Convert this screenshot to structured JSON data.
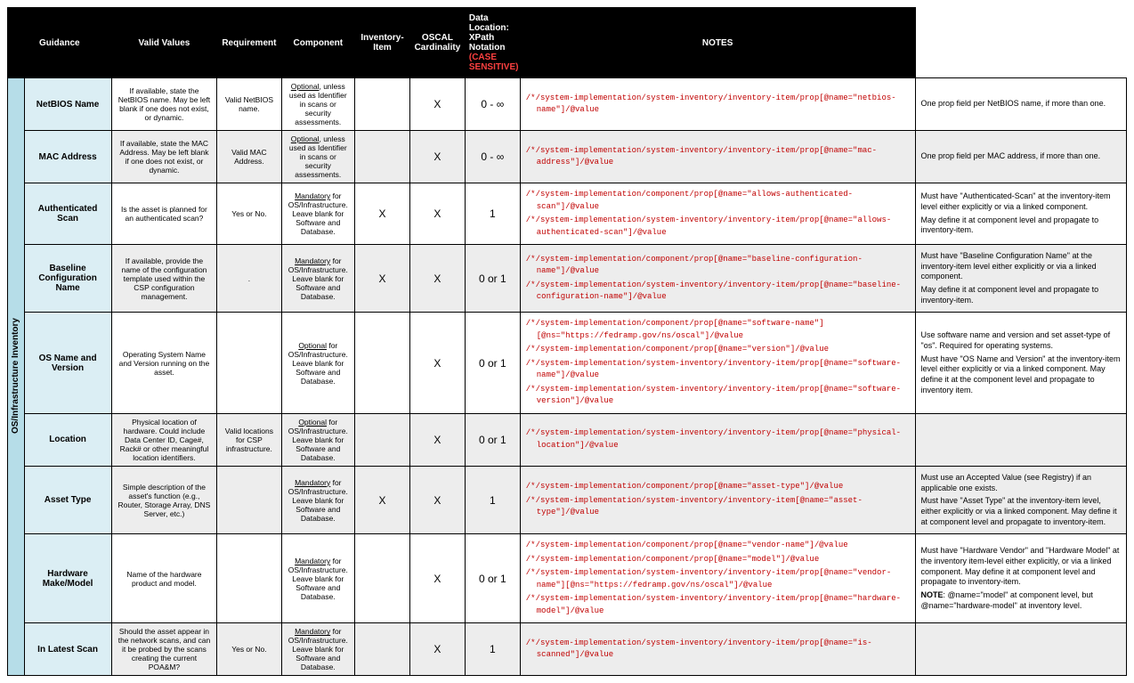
{
  "section": "OS/Infrastructure Inventory",
  "headers": {
    "c1": "Guidance",
    "c2": "Valid Values",
    "c3": "Requirement",
    "c4": "Component",
    "c5": "Inventory-Item",
    "c6": "OSCAL Cardinality",
    "c7a": "Data Location: XPath Notation ",
    "c7b": "(CASE SENSITIVE)",
    "c8": "NOTES"
  },
  "rows": [
    {
      "name": "NetBIOS Name",
      "guidance": "If available, state the NetBIOS name. May be left blank if one does not exist, or dynamic.",
      "valid": "Valid NetBIOS name.",
      "req_pre": "Optional",
      "req_post": ", unless used as Identifier in scans or security assessments.",
      "comp": "",
      "inv": "X",
      "card": "0 - ∞",
      "xpaths": [
        "/*/system-implementation/system-inventory/inventory-item/prop[@name=\"netbios-name\"]/@value"
      ],
      "notes": [
        "One prop field per NetBIOS name, if more than one."
      ],
      "shade": false
    },
    {
      "name": "MAC Address",
      "guidance": "If available, state the MAC Address. May be left blank if one does not exist, or dynamic.",
      "valid": "Valid MAC Address.",
      "req_pre": "Optional",
      "req_post": ", unless used as Identifier in scans or security assessments.",
      "comp": "",
      "inv": "X",
      "card": "0 - ∞",
      "xpaths": [
        "/*/system-implementation/system-inventory/inventory-item/prop[@name=\"mac-address\"]/@value"
      ],
      "notes": [
        "One prop field per MAC address, if more than one."
      ],
      "shade": true
    },
    {
      "name": "Authenticated Scan",
      "guidance": "Is the asset is planned for an authenticated scan?",
      "valid": "Yes or No.",
      "req_pre": "Mandatory",
      "req_post": " for OS/Infrastructure. Leave blank for Software and Database.",
      "comp": "X",
      "inv": "X",
      "card": "1",
      "xpaths": [
        "/*/system-implementation/component/prop[@name=\"allows-authenticated-scan\"]/@value",
        "/*/system-implementation/system-inventory/inventory-item/prop[@name=\"allows-authenticated-scan\"]/@value"
      ],
      "notes": [
        "Must have \"Authenticated-Scan\" at the inventory-item level either explicitly or via a linked component.",
        "May define it at component level and propagate to inventory-item."
      ],
      "shade": false
    },
    {
      "name": "Baseline Configuration Name",
      "guidance": "If available, provide the name of the configuration template used within the CSP configuration management.",
      "valid": ".",
      "req_pre": "Mandatory",
      "req_post": " for OS/Infrastructure. Leave blank for Software and Database.",
      "comp": "X",
      "inv": "X",
      "card": "0 or 1",
      "xpaths": [
        "/*/system-implementation/component/prop[@name=\"baseline-configuration-name\"]/@value",
        "/*/system-implementation/system-inventory/inventory-item/prop[@name=\"baseline-configuration-name\"]/@value"
      ],
      "notes": [
        "Must have \"Baseline Configuration Name\" at the inventory-item level either explicitly or via a linked component.",
        "May define it at component level and propagate to inventory-item."
      ],
      "shade": true
    },
    {
      "name": "OS Name and Version",
      "guidance": "Operating System Name and Version running on the asset.",
      "valid": "",
      "req_pre": "Optional",
      "req_post": " for OS/Infrastructure. Leave blank for Software and Database.",
      "comp": "",
      "inv": "X",
      "card": "0 or 1",
      "xpaths": [
        "/*/system-implementation/component/prop[@name=\"software-name\"][@ns=\"https://fedramp.gov/ns/oscal\"]/@value",
        "/*/system-implementation/component/prop[@name=\"version\"]/@value",
        "/*/system-implementation/system-inventory/inventory-item/prop[@name=\"software-name\"]/@value",
        "/*/system-implementation/system-inventory/inventory-item/prop[@name=\"software-version\"]/@value"
      ],
      "notes": [
        "Use software name and version and set asset-type of \"os\".\nRequired for operating systems.",
        "Must have \"OS Name and Version\" at the inventory-item level either explicitly or via a linked component. May define it at the component level and propagate to inventory item."
      ],
      "shade": false
    },
    {
      "name": "Location",
      "guidance": "Physical location of hardware. Could include Data Center ID, Cage#, Rack# or other meaningful location identifiers.",
      "valid": "Valid locations for CSP infrastructure.",
      "req_pre": "Optional",
      "req_post": " for OS/Infrastructure. Leave blank for Software and Database.",
      "comp": "",
      "inv": "X",
      "card": "0 or 1",
      "xpaths": [
        "/*/system-implementation/system-inventory/inventory-item/prop[@name=\"physical-location\"]/@value"
      ],
      "notes": [],
      "shade": true
    },
    {
      "name": "Asset Type",
      "guidance": "Simple description of the asset's function (e.g., Router, Storage Array, DNS Server, etc.)",
      "valid": "",
      "req_pre": "Mandatory",
      "req_post": " for OS/Infrastructure. Leave blank for Software and Database.",
      "comp": "X",
      "inv": "X",
      "card": "1",
      "xpaths": [
        "/*/system-implementation/component/prop[@name=\"asset-type\"]/@value",
        "/*/system-implementation/system-inventory/inventory-item[@name=\"asset-type\"]/@value"
      ],
      "notes": [
        "Must use an Accepted Value (see Registry) if an applicable one exists.",
        "Must have \"Asset Type\" at the inventory-item level, either explicitly or via a linked component. May define it at component level and propagate to inventory-item."
      ],
      "shade": true
    },
    {
      "name": "Hardware Make/Model",
      "guidance": "Name of the hardware product and model.",
      "valid": "",
      "req_pre": "Mandatory",
      "req_post": " for OS/Infrastructure. Leave blank for Software and Database.",
      "comp": "",
      "inv": "X",
      "card": "0 or 1",
      "xpaths": [
        "/*/system-implementation/component/prop[@name=\"vendor-name\"]/@value",
        "/*/system-implementation/component/prop[@name=\"model\"]/@value",
        "/*/system-implementation/system-inventory/inventory-item/prop[@name=\"vendor-name\"][@ns=\"https://fedramp.gov/ns/oscal\"]/@value",
        "/*/system-implementation/system-inventory/inventory-item/prop[@name=\"hardware-model\"]/@value"
      ],
      "notes": [
        "Must have \"Hardware Vendor\" and \"Hardware Model\" at the inventory item-level either explicitly, or via a linked component. May define it at component level and propagate to inventory-item.",
        "<b>NOTE</b>: @name=\"model\" at component level, but @name=\"hardware-model\" at inventory level."
      ],
      "shade": false
    },
    {
      "name": "In Latest Scan",
      "guidance": "Should the asset appear in the network scans, and can it be probed by the scans creating the current POA&M?",
      "valid": "Yes or No.",
      "req_pre": "Mandatory",
      "req_post": " for OS/Infrastructure. Leave blank for Software and Database.",
      "comp": "",
      "inv": "X",
      "card": "1",
      "xpaths": [
        "/*/system-implementation/system-inventory/inventory-item/prop[@name=\"is-scanned\"]/@value"
      ],
      "notes": [],
      "shade": true
    }
  ]
}
